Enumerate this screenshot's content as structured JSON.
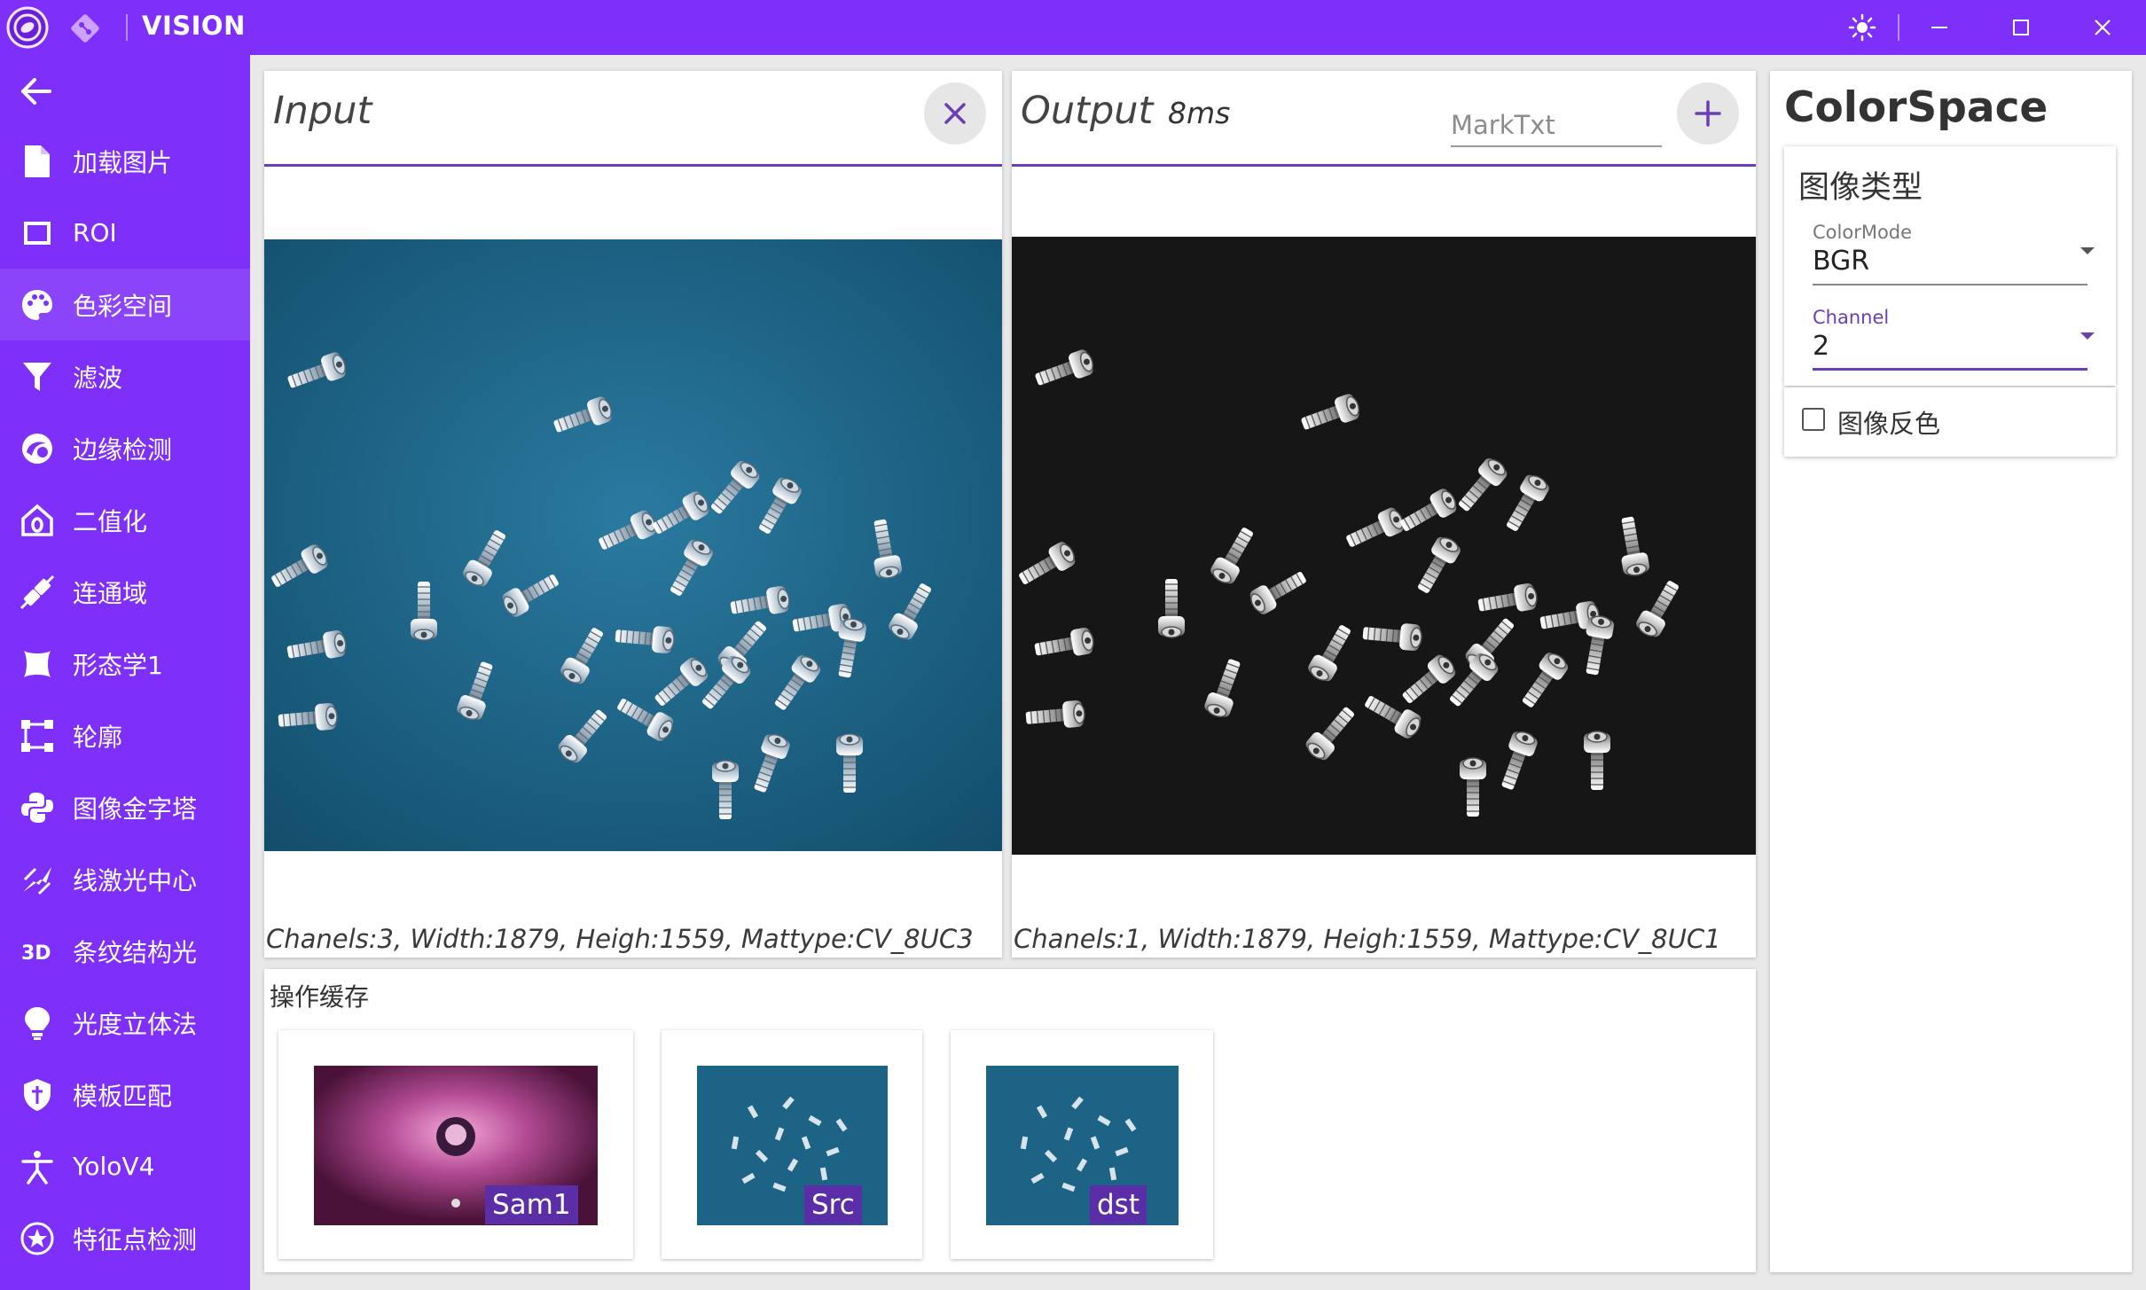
{
  "app": {
    "title": "VISION",
    "accent": "#7f2ffa",
    "icons": [
      "app-logo-icon",
      "git-icon",
      "theme-sun-icon",
      "minimize-icon",
      "maximize-icon",
      "close-icon"
    ]
  },
  "sidebar": {
    "back_icon": "arrow-left-icon",
    "items": [
      {
        "label": "加载图片",
        "icon": "file-icon"
      },
      {
        "label": "ROI",
        "icon": "square-outline-icon"
      },
      {
        "label": "色彩空间",
        "icon": "palette-icon",
        "active": true
      },
      {
        "label": "滤波",
        "icon": "filter-icon"
      },
      {
        "label": "边缘检测",
        "icon": "edge-icon"
      },
      {
        "label": "二值化",
        "icon": "home-zero-icon"
      },
      {
        "label": "连通域",
        "icon": "connection-icon"
      },
      {
        "label": "形态学1",
        "icon": "morphology-icon"
      },
      {
        "label": "轮廓",
        "icon": "contour-icon"
      },
      {
        "label": "图像金字塔",
        "icon": "python-icon"
      },
      {
        "label": "线激光中心",
        "icon": "laser-icon"
      },
      {
        "label": "条纹结构光",
        "icon": "3d-icon"
      },
      {
        "label": "光度立体法",
        "icon": "lightbulb-icon"
      },
      {
        "label": "模板匹配",
        "icon": "shield-icon"
      },
      {
        "label": "YoloV4",
        "icon": "human-icon"
      },
      {
        "label": "特征点检测",
        "icon": "star-circle-icon"
      }
    ]
  },
  "input_panel": {
    "title": "Input",
    "status": "Chanels:3, Width:1879, Heigh:1559, Mattype:CV_8UC3"
  },
  "output_panel": {
    "title": "Output",
    "timing": "8ms",
    "mark_placeholder": "MarkTxt",
    "status": "Chanels:1, Width:1879, Heigh:1559, Mattype:CV_8UC1"
  },
  "cache": {
    "title": "操作缓存",
    "items": [
      {
        "label": "Sam1"
      },
      {
        "label": "Src"
      },
      {
        "label": "dst"
      }
    ]
  },
  "colorspace": {
    "title": "ColorSpace",
    "group_title": "图像类型",
    "colormode_label": "ColorMode",
    "colormode_value": "BGR",
    "channel_label": "Channel",
    "channel_value": "2",
    "invert_label": "图像反色",
    "invert_checked": false
  }
}
